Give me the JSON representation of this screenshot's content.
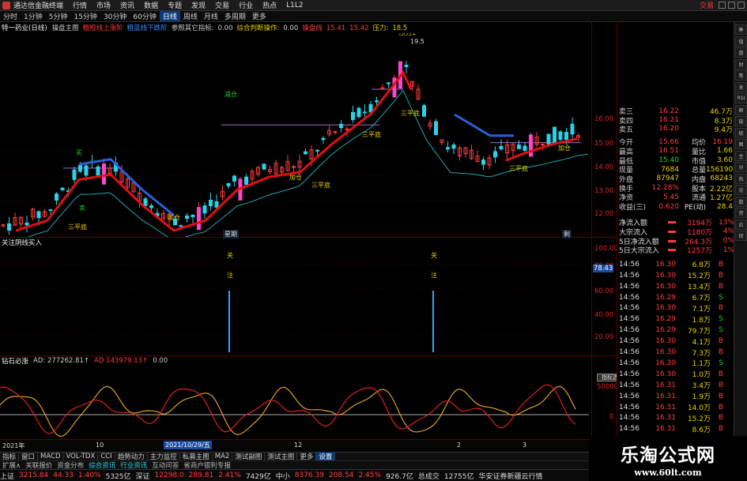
{
  "menubar": {
    "app_title": "通达信金融终端",
    "items": [
      "行情",
      "市场",
      "资讯",
      "数据",
      "专题",
      "发现",
      "交易",
      "行业",
      "热点",
      "L1L2"
    ],
    "trade": "交易",
    "window_buttons": [
      "minimize-icon",
      "maximize-icon",
      "close-icon"
    ]
  },
  "periodbar": {
    "items": [
      "分时",
      "1分钟",
      "5分钟",
      "15分钟",
      "30分钟",
      "60分钟",
      "日线",
      "周线",
      "月线",
      "多周期",
      "更多"
    ],
    "active": "日线"
  },
  "main_header": {
    "stock": "特一药业(日线)",
    "tags": [
      {
        "text": "操盘主图",
        "color": "#ccc"
      },
      {
        "text": "粗短线上涨阶",
        "color": "#ff3c3c"
      },
      {
        "text": "粗蓝线下跌阶",
        "color": "#3c8cff"
      },
      {
        "text": "参照其它指标:",
        "color": "#ccc"
      },
      {
        "text": "0.00",
        "color": "#ccc"
      },
      {
        "text": "综合判断操作:",
        "color": "#e6d200"
      },
      {
        "text": "0.00",
        "color": "#ccc"
      },
      {
        "text": "操盘线",
        "color": "#ff3c3c"
      },
      {
        "text": "15.41",
        "color": "#ff3c3c"
      },
      {
        "text": "15.42",
        "color": "#ff3c3c"
      },
      {
        "text": "压力:",
        "color": "#e6d200"
      },
      {
        "text": "18.5",
        "color": "#e6d200"
      }
    ]
  },
  "main_axis": [
    "16.00",
    "15.00",
    "14.00",
    "13.00",
    "12.00"
  ],
  "main_marks": [
    {
      "text": "三平底",
      "color": "#e6d200"
    },
    {
      "text": "三平底",
      "color": "#e6d200"
    },
    {
      "text": "三平底",
      "color": "#e6d200"
    },
    {
      "text": "三平底",
      "color": "#e6d200"
    },
    {
      "text": "三平底",
      "color": "#e6d200"
    },
    {
      "text": "加仓",
      "color": "#e6d200"
    },
    {
      "text": "加仓",
      "color": "#e6d200"
    },
    {
      "text": "加仓",
      "color": "#e6d200"
    },
    {
      "text": "减仓",
      "color": "#1fd31f"
    },
    {
      "text": "买",
      "color": "#1fd31f"
    },
    {
      "text": "卖",
      "color": "#1fd31f"
    },
    {
      "text": "压力1",
      "color": "#e6d200"
    },
    {
      "text": "19.5",
      "color": "#ddd"
    }
  ],
  "main_price_tags": [
    "星期",
    "剩"
  ],
  "ind1_header": {
    "name": "关注阴线买入",
    "axis": [
      "100.00",
      "80.00",
      "78.43",
      "60.00",
      "40.00",
      "20.00"
    ],
    "marks": [
      "关",
      "注",
      "关",
      "注"
    ]
  },
  "ind2_header": {
    "name": "钻石必涨",
    "items": [
      {
        "text": "AD: 277262.81↑",
        "color": "#ccc"
      },
      {
        "text": "AD 143979.13↑",
        "color": "#ff3c3c"
      },
      {
        "text": "0.00",
        "color": "#ccc"
      }
    ],
    "axis": [
      "50000",
      "0"
    ],
    "tooltip": "指标选项",
    "timeline": [
      "2021年",
      "10",
      "2021/10/29/五",
      "12",
      "2",
      "3"
    ]
  },
  "quote": {
    "ask_rows": [
      {
        "label": "卖三",
        "price": "16.22",
        "vol": "46.7万"
      },
      {
        "label": "卖四",
        "price": "16.21",
        "vol": "8.3万"
      },
      {
        "label": "卖五",
        "price": "16.20",
        "vol": "9.4万"
      }
    ],
    "stats": [
      {
        "l1": "今开",
        "v1": "15.66",
        "l2": "均价",
        "v2": "16.19"
      },
      {
        "l1": "最高",
        "v1": "16.51",
        "l2": "量比",
        "v2": "1.66"
      },
      {
        "l1": "最低",
        "v1": "15.40",
        "l2": "市值",
        "v2": "3.60"
      },
      {
        "l1": "现量",
        "v1": "7684",
        "l2": "总量",
        "v2": "156190"
      },
      {
        "l1": "外盘",
        "v1": "87947",
        "l2": "内盘",
        "v2": "68243"
      },
      {
        "l1": "换手",
        "v1": "12.28%",
        "l2": "股本",
        "v2": "2.22亿"
      },
      {
        "l1": "净资",
        "v1": "5.45",
        "l2": "流通",
        "v2": "1.27亿"
      },
      {
        "l1": "收益(三)",
        "v1": "0.620",
        "l2": "PE(动)",
        "v2": "28.4"
      }
    ],
    "flows": [
      {
        "label": "净流入额",
        "value": "3194万",
        "pct": "13%"
      },
      {
        "label": "大宗流入",
        "value": "1180万",
        "pct": "4%"
      },
      {
        "label": "5日净流入额",
        "value": "264.3万",
        "pct": "0%"
      },
      {
        "label": "5日大宗流入",
        "value": "1257万",
        "pct": "1%"
      }
    ],
    "trades": [
      {
        "t": "14:56",
        "p": "16.30",
        "v": "6.8万",
        "d": "B"
      },
      {
        "t": "14:56",
        "p": "16.30",
        "v": "15.2万",
        "d": "B"
      },
      {
        "t": "14:56",
        "p": "16.30",
        "v": "13.4万",
        "d": "B"
      },
      {
        "t": "14:56",
        "p": "16.29",
        "v": "6.7万",
        "d": "S"
      },
      {
        "t": "14:56",
        "p": "16.30",
        "v": "7.1万",
        "d": "B"
      },
      {
        "t": "14:56",
        "p": "16.29",
        "v": "1.8万",
        "d": "S"
      },
      {
        "t": "14:56",
        "p": "16.29",
        "v": "79.7万",
        "d": "S"
      },
      {
        "t": "14:56",
        "p": "16.30",
        "v": "4.1万",
        "d": "B"
      },
      {
        "t": "14:56",
        "p": "16.30",
        "v": "7.3万",
        "d": "B"
      },
      {
        "t": "14:56",
        "p": "16.30",
        "v": "1.1万",
        "d": "S"
      },
      {
        "t": "14:56",
        "p": "16.30",
        "v": "1.0万",
        "d": "B"
      },
      {
        "t": "14:56",
        "p": "16.31",
        "v": "3.4万",
        "d": "B"
      },
      {
        "t": "14:56",
        "p": "16.31",
        "v": "1.9万",
        "d": "B"
      },
      {
        "t": "14:56",
        "p": "16.31",
        "v": "14.0万",
        "d": "B"
      },
      {
        "t": "14:56",
        "p": "16.31",
        "v": "15.2万",
        "d": "B"
      },
      {
        "t": "14:56",
        "p": "16.31",
        "v": "8.6万",
        "d": "B"
      },
      {
        "t": "14:56",
        "p": "16.31",
        "v": "25.3万",
        "d": "B"
      },
      {
        "t": "14:56",
        "p": "16.31",
        "v": "4.5万",
        "d": "B"
      }
    ]
  },
  "sidebar_tabs": [
    "筹",
    "值",
    "盘",
    "财",
    "笔",
    "关",
    "RSI",
    "顺",
    "链",
    "统",
    "图",
    "主",
    "分",
    "热",
    "论",
    "数",
    "资",
    "应",
    "综"
  ],
  "tabbar1": [
    "指标",
    "窗口",
    "MACD",
    "VOL-TDX",
    "CCI",
    "趋势动力",
    "主力监控",
    "私募主图",
    "MA2",
    "测试副图",
    "测试主图",
    "更多",
    "设置"
  ],
  "tabbar1_active": "设置",
  "tabbar2": [
    {
      "text": "扩展∧",
      "hl": false
    },
    {
      "text": "关联报价",
      "hl": false
    },
    {
      "text": "资金分布",
      "hl": false
    },
    {
      "text": "综合资讯",
      "hl": true
    },
    {
      "text": "行业资讯",
      "hl": true
    },
    {
      "text": "互动问答",
      "hl": false
    },
    {
      "text": "省商户银利专报",
      "hl": false
    }
  ],
  "tabbar2_right": [
    "图方F10",
    "模板"
  ],
  "statusbar": [
    {
      "text": "上证",
      "color": "#ddd"
    },
    {
      "text": "3215.84",
      "color": "#ff3c3c"
    },
    {
      "text": "44.33",
      "color": "#ff3c3c"
    },
    {
      "text": "1.40%",
      "color": "#ff3c3c"
    },
    {
      "text": "5325亿",
      "color": "#ddd"
    },
    {
      "text": "深证",
      "color": "#ddd"
    },
    {
      "text": "12298.0",
      "color": "#ff3c3c"
    },
    {
      "text": "289.81",
      "color": "#ff3c3c"
    },
    {
      "text": "2.41%",
      "color": "#ff3c3c"
    },
    {
      "text": "7429亿",
      "color": "#ddd"
    },
    {
      "text": "中小",
      "color": "#ddd"
    },
    {
      "text": "8376.39",
      "color": "#ff3c3c"
    },
    {
      "text": "208.54",
      "color": "#ff3c3c"
    },
    {
      "text": "2.45%",
      "color": "#ff3c3c"
    },
    {
      "text": "926.7亿",
      "color": "#ddd"
    },
    {
      "text": "总成交",
      "color": "#ddd"
    },
    {
      "text": "12755亿",
      "color": "#ddd"
    },
    {
      "text": "华安证券新疆云行情",
      "color": "#ddd"
    }
  ],
  "watermark": {
    "line1": "乐淘公式网",
    "line2": "www.60lt.com"
  },
  "colors": {
    "up": "#ff3c3c",
    "down": "#29d2e8",
    "avg_up": "#e01010",
    "avg_down": "#2a5fd8",
    "support": "#20a8b0",
    "grid": "#5a0000"
  }
}
